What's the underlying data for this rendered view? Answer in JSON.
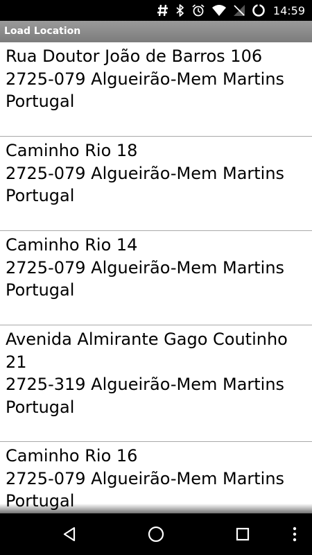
{
  "status_bar": {
    "time": "14:59",
    "icons": [
      "hash-icon",
      "bluetooth-icon",
      "alarm-icon",
      "wifi-icon",
      "no-signal-icon",
      "battery-charging-icon"
    ]
  },
  "app": {
    "title": "Load Location"
  },
  "locations": [
    {
      "address": "Rua Doutor João de Barros 106\n2725-079 Algueirão-Mem Martins\nPortugal"
    },
    {
      "address": "Caminho Rio 18\n2725-079 Algueirão-Mem Martins\nPortugal"
    },
    {
      "address": "Caminho Rio 14\n2725-079 Algueirão-Mem Martins\nPortugal"
    },
    {
      "address": "Avenida Almirante Gago Coutinho\n21\n2725-319 Algueirão-Mem Martins\nPortugal"
    },
    {
      "address": "Caminho Rio 16\n2725-079 Algueirão-Mem Martins\nPortugal"
    }
  ],
  "nav_bar": {
    "icons": [
      "back-icon",
      "home-icon",
      "recents-icon",
      "overflow-menu-icon"
    ]
  }
}
